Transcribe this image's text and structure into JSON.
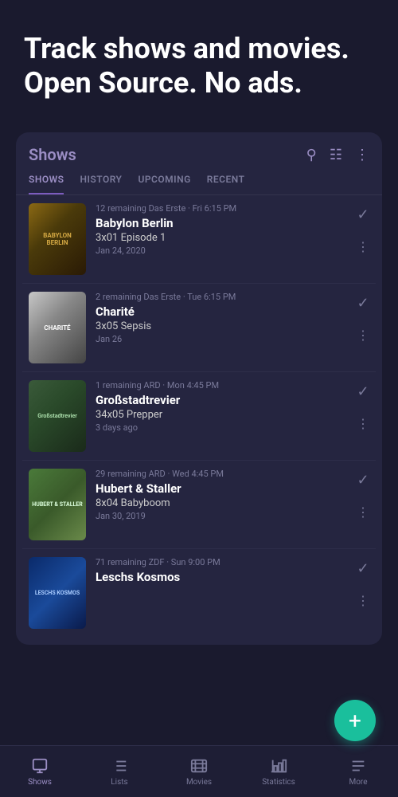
{
  "hero": {
    "title": "Track shows and movies. Open Source. No ads."
  },
  "card": {
    "title": "Shows",
    "tabs": [
      {
        "label": "SHOWS",
        "active": true
      },
      {
        "label": "HISTORY",
        "active": false
      },
      {
        "label": "UPCOMING",
        "active": false
      },
      {
        "label": "RECENT",
        "active": false
      }
    ]
  },
  "shows": [
    {
      "poster_label": "BABYLON BERLIN",
      "meta": "12 remaining  Das Erste · Fri 6:15 PM",
      "name": "Babylon Berlin",
      "episode": "3x01 Episode 1",
      "date": "Jan 24, 2020"
    },
    {
      "poster_label": "CHARITÉ",
      "meta": "2 remaining  Das Erste · Tue 6:15 PM",
      "name": "Charité",
      "episode": "3x05 Sepsis",
      "date": "Jan 26"
    },
    {
      "poster_label": "Großstadtrevier",
      "meta": "1 remaining  ARD · Mon 4:45 PM",
      "name": "Großstadtrevier",
      "episode": "34x05 Prepper",
      "date": "3 days ago"
    },
    {
      "poster_label": "HUBERT & STALLER",
      "meta": "29 remaining  ARD · Wed 4:45 PM",
      "name": "Hubert & Staller",
      "episode": "8x04 Babyboom",
      "date": "Jan 30, 2019"
    },
    {
      "poster_label": "LESCHS KOSMOS",
      "meta": "71 remaining  ZDF · Sun 9:00 PM",
      "name": "Leschs Kosmos",
      "episode": "",
      "date": ""
    }
  ],
  "fab": {
    "label": "+"
  },
  "bottom_nav": [
    {
      "label": "Shows",
      "active": true
    },
    {
      "label": "Lists",
      "active": false
    },
    {
      "label": "Movies",
      "active": false
    },
    {
      "label": "Statistics",
      "active": false
    },
    {
      "label": "More",
      "active": false
    }
  ]
}
